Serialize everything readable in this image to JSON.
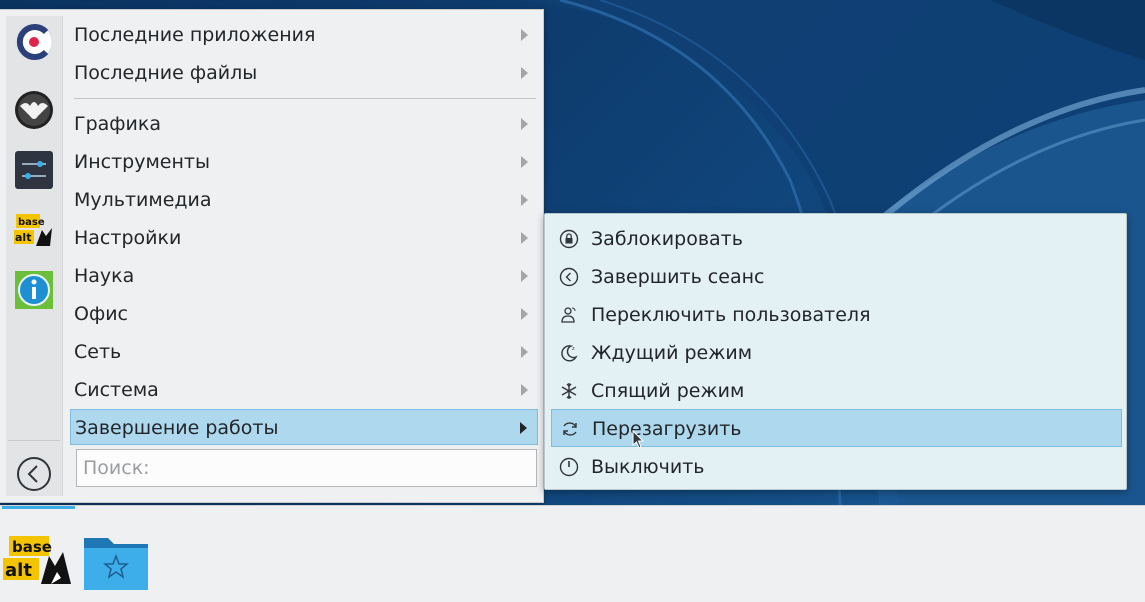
{
  "desktop": {
    "wallpaper": "blue-curves"
  },
  "main_menu": {
    "favorites": [
      {
        "name": "communication-app",
        "icon": "c-ring-icon"
      },
      {
        "name": "gimp-like",
        "icon": "bat-globe-icon"
      },
      {
        "name": "settings-app",
        "icon": "sliders-icon"
      },
      {
        "name": "basealt-app",
        "icon": "basealt-logo",
        "logo_text": "base alt"
      },
      {
        "name": "info-app",
        "icon": "info-icon"
      }
    ],
    "items": [
      {
        "label": "Последние приложения",
        "has_submenu": true
      },
      {
        "label": "Последние файлы",
        "has_submenu": true
      },
      {
        "label": "Графика",
        "has_submenu": true
      },
      {
        "label": "Инструменты",
        "has_submenu": true
      },
      {
        "label": "Мультимедиа",
        "has_submenu": true
      },
      {
        "label": "Настройки",
        "has_submenu": true
      },
      {
        "label": "Наука",
        "has_submenu": true
      },
      {
        "label": "Офис",
        "has_submenu": true
      },
      {
        "label": "Сеть",
        "has_submenu": true
      },
      {
        "label": "Система",
        "has_submenu": true
      },
      {
        "label": "Завершение работы",
        "has_submenu": true,
        "active": true
      }
    ],
    "search": {
      "placeholder": "Поиск:",
      "value": ""
    }
  },
  "sub_menu": {
    "items": [
      {
        "label": "Заблокировать",
        "icon": "lock-icon"
      },
      {
        "label": "Завершить сеанс",
        "icon": "logout-icon"
      },
      {
        "label": "Переключить пользователя",
        "icon": "switch-user-icon"
      },
      {
        "label": "Ждущий режим",
        "icon": "moon-icon"
      },
      {
        "label": "Спящий режим",
        "icon": "snowflake-icon"
      },
      {
        "label": "Перезагрузить",
        "icon": "restart-icon",
        "active": true
      },
      {
        "label": "Выключить",
        "icon": "power-icon"
      }
    ]
  },
  "taskbar": {
    "items": [
      {
        "name": "basealt-launcher",
        "icon": "basealt-logo",
        "logo_text": "base alt"
      },
      {
        "name": "favorites-folder",
        "icon": "folder-star-icon"
      }
    ]
  },
  "colors": {
    "highlight": "#aed8ee",
    "highlight_border": "#7fbde0",
    "accent": "#3daee9",
    "menu_bg": "#eff0f1",
    "submenu_bg": "#e3f1f5"
  }
}
